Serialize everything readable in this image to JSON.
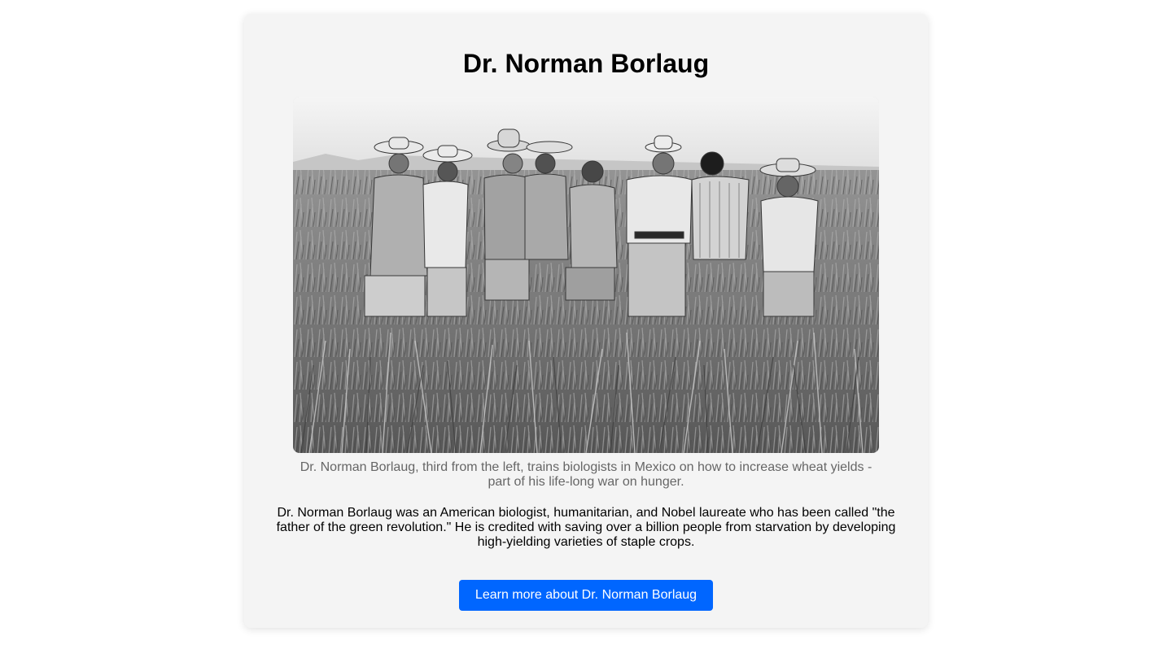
{
  "card": {
    "title": "Dr. Norman Borlaug",
    "image": {
      "icon": "photo-wheat-field-group",
      "caption": "Dr. Norman Borlaug, third from the left, trains biologists in Mexico on how to increase wheat yields - part of his life-long war on hunger."
    },
    "description": "Dr. Norman Borlaug was an American biologist, humanitarian, and Nobel laureate who has been called \"the father of the green revolution.\" He is credited with saving over a billion people from starvation by developing high-yielding varieties of staple crops.",
    "cta_label": "Learn more about Dr. Norman Borlaug"
  },
  "colors": {
    "card_background": "#f4f4f4",
    "button": "#0066ff",
    "caption_text": "#666666"
  }
}
